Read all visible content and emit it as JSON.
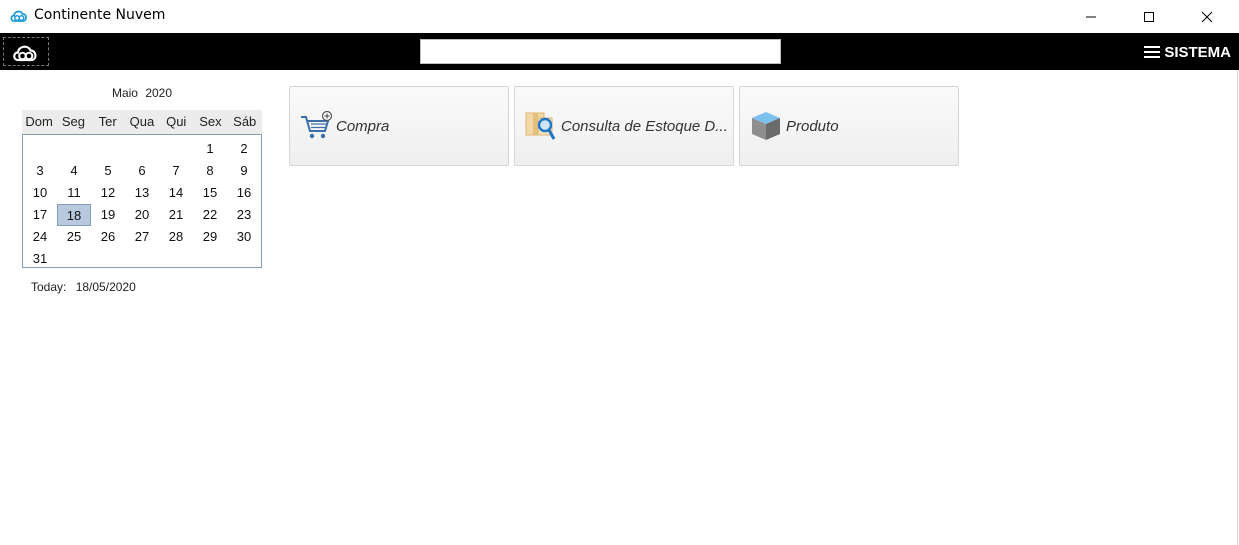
{
  "window": {
    "title": "Continente Nuvem",
    "controls": [
      "minimize",
      "maximize",
      "close"
    ]
  },
  "toolbar": {
    "logo_icon": "cloud-logo-icon",
    "search": {
      "value": "",
      "placeholder": ""
    },
    "menu_label": "SISTEMA",
    "menu_icon": "hamburger-icon"
  },
  "calendar": {
    "month": "Maio",
    "year": "2020",
    "weekdays": [
      "Dom",
      "Seg",
      "Ter",
      "Qua",
      "Qui",
      "Sex",
      "Sáb"
    ],
    "weeks": [
      [
        "",
        "",
        "",
        "",
        "",
        "1",
        "2"
      ],
      [
        "3",
        "4",
        "5",
        "6",
        "7",
        "8",
        "9"
      ],
      [
        "10",
        "11",
        "12",
        "13",
        "14",
        "15",
        "16"
      ],
      [
        "17",
        "18",
        "19",
        "20",
        "21",
        "22",
        "23"
      ],
      [
        "24",
        "25",
        "26",
        "27",
        "28",
        "29",
        "30"
      ],
      [
        "31",
        "",
        "",
        "",
        "",
        "",
        ""
      ]
    ],
    "selected_day": "18",
    "today_label": "Today:",
    "today_value": "18/05/2020"
  },
  "shortcuts": [
    {
      "label": "Compra",
      "icon": "shopping-cart-icon"
    },
    {
      "label": "Consulta de Estoque D...",
      "icon": "inventory-search-icon"
    },
    {
      "label": "Produto",
      "icon": "product-box-icon"
    }
  ],
  "colors": {
    "toolbar_bg": "#000000",
    "selected_day_bg": "#b8c9df",
    "calendar_border": "#7f9db9",
    "app_icon": "#1e9bd7"
  }
}
